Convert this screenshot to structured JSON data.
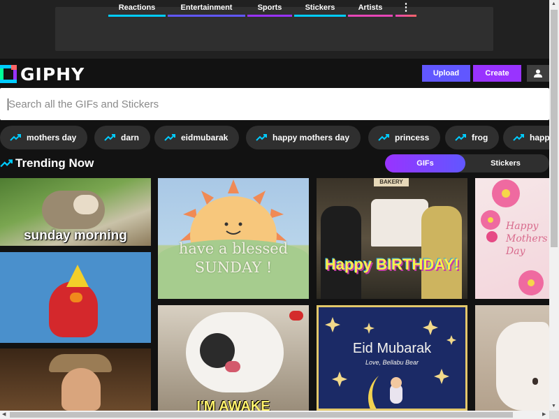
{
  "brand": {
    "name": "GIPHY"
  },
  "nav": {
    "items": [
      {
        "label": "Reactions",
        "color": "#00ccff"
      },
      {
        "label": "Entertainment",
        "color": "#6157ff"
      },
      {
        "label": "Sports",
        "color": "#9933ff"
      },
      {
        "label": "Stickers",
        "color": "#00ccff"
      },
      {
        "label": "Artists",
        "color": "#e646b6"
      }
    ],
    "more_icon": "⋮"
  },
  "actions": {
    "upload_label": "Upload",
    "create_label": "Create"
  },
  "search": {
    "placeholder": "Search all the GIFs and Stickers",
    "value": ""
  },
  "trending_tags": [
    "mothers day",
    "darn",
    "eidmubarak",
    "happy mothers day",
    "princess",
    "frog",
    "happ"
  ],
  "trending": {
    "title": "Trending Now"
  },
  "toggle": {
    "gifs_label": "GIFs",
    "stickers_label": "Stickers",
    "active": "GIFs"
  },
  "gifs": [
    {
      "caption": "sunday morning"
    },
    {
      "caption": "have a blessed SUNDAY !"
    },
    {
      "caption": "Happy BIRTHDAY!",
      "sign": "BAKERY"
    },
    {
      "caption": "Happy Mothers Day"
    },
    {
      "caption": ""
    },
    {
      "caption": "I'M AWAKE"
    },
    {
      "caption": "Eid Mubarak",
      "subcaption": "Love, Bellabu Bear"
    },
    {
      "caption": ""
    },
    {
      "caption": ""
    }
  ],
  "colors": {
    "accent_purple": "#9933ff",
    "accent_blue": "#6157ff",
    "background": "#121212"
  }
}
